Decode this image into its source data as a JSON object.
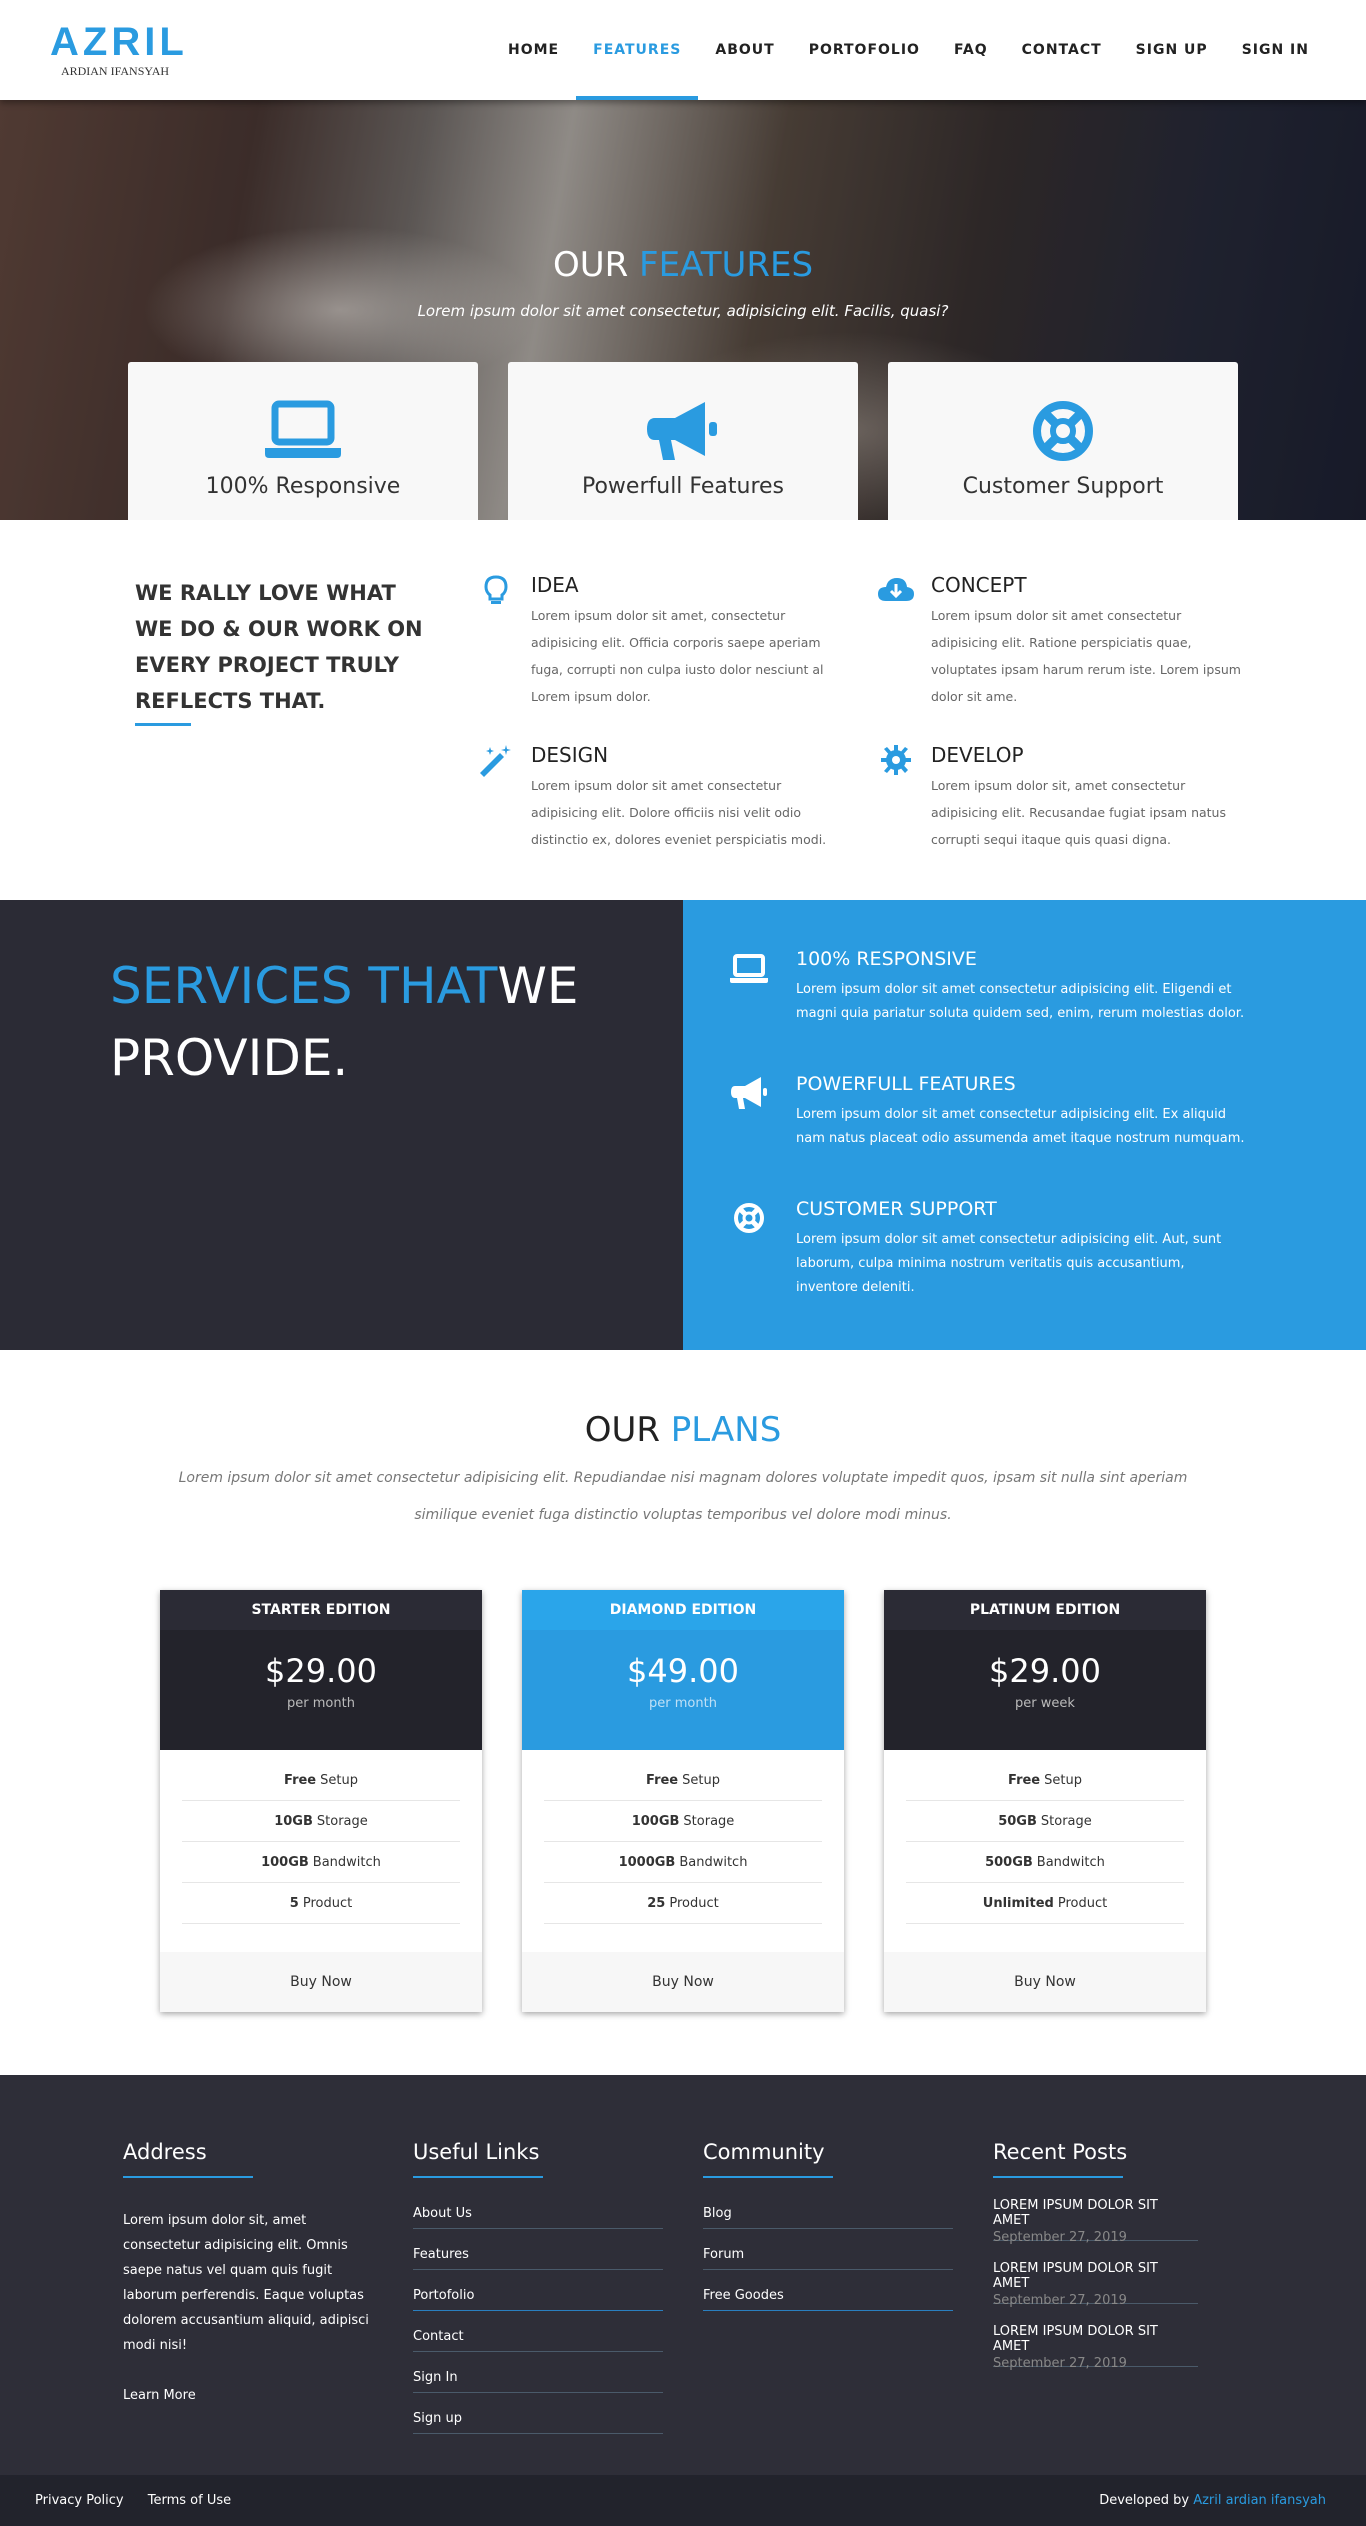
{
  "brand": {
    "name": "AZRIL",
    "sub": "ARDIAN IFANSYAH"
  },
  "nav": [
    {
      "label": "HOME",
      "active": false
    },
    {
      "label": "FEATURES",
      "active": true
    },
    {
      "label": "ABOUT",
      "active": false
    },
    {
      "label": "PORTOFOLIO",
      "active": false
    },
    {
      "label": "FAQ",
      "active": false
    },
    {
      "label": "CONTACT",
      "active": false
    },
    {
      "label": "SIGN UP",
      "active": false
    },
    {
      "label": "SIGN IN",
      "active": false
    }
  ],
  "hero": {
    "title_prefix": "OUR",
    "title_accent": "FEATURES",
    "subtitle": "Lorem ipsum dolor sit amet consectetur, adipisicing elit. Facilis, quasi?",
    "cards": [
      {
        "label": "100% Responsive",
        "icon": "laptop-icon"
      },
      {
        "label": "Powerfull Features",
        "icon": "megaphone-icon"
      },
      {
        "label": "Customer Support",
        "icon": "lifebuoy-icon"
      }
    ]
  },
  "about": {
    "heading": "WE RALLY LOVE WHAT WE DO & OUR WORK ON EVERY PROJECT TRULY REFLECTS THAT.",
    "items": [
      {
        "title": "IDEA",
        "icon": "lightbulb-icon",
        "text": "Lorem ipsum dolor sit amet, consectetur adipisicing elit. Officia corporis saepe aperiam fuga, corrupti non culpa iusto dolor nesciunt al Lorem ipsum dolor."
      },
      {
        "title": "CONCEPT",
        "icon": "cloud-download-icon",
        "text": "Lorem ipsum dolor sit amet consectetur adipisicing elit. Ratione perspiciatis quae, voluptates ipsam harum rerum iste. Lorem ipsum dolor sit ame."
      },
      {
        "title": "DESIGN",
        "icon": "magic-wand-icon",
        "text": "Lorem ipsum dolor sit amet consectetur adipisicing elit. Dolore officiis nisi velit odio distinctio ex, dolores eveniet perspiciatis modi."
      },
      {
        "title": "DEVELOP",
        "icon": "gear-icon",
        "text": "Lorem ipsum dolor sit, amet consectetur adipisicing elit. Recusandae fugiat ipsam natus corrupti sequi itaque quis quasi digna."
      }
    ]
  },
  "services": {
    "title_accent": "SERVICES THAT",
    "title_rest": "WE PROVIDE.",
    "items": [
      {
        "title": "100% RESPONSIVE",
        "icon": "laptop-icon",
        "text": "Lorem ipsum dolor sit amet consectetur adipisicing elit. Eligendi et magni quia pariatur soluta quidem sed, enim, rerum molestias dolor."
      },
      {
        "title": "POWERFULL FEATURES",
        "icon": "megaphone-icon",
        "text": "Lorem ipsum dolor sit amet consectetur adipisicing elit. Ex aliquid nam natus placeat odio assumenda amet itaque nostrum numquam."
      },
      {
        "title": "CUSTOMER SUPPORT",
        "icon": "lifebuoy-icon",
        "text": "Lorem ipsum dolor sit amet consectetur adipisicing elit. Aut, sunt laborum, culpa minima nostrum veritatis quis accusantium, inventore deleniti."
      }
    ]
  },
  "plans": {
    "title_prefix": "OUR",
    "title_accent": "PLANS",
    "subtitle": "Lorem ipsum dolor sit amet consectetur adipisicing elit. Repudiandae nisi magnam dolores voluptate impedit quos, ipsam sit nulla sint aperiam similique eveniet fuga distinctio voluptas temporibus vel dolore modi minus.",
    "cards": [
      {
        "name": "STARTER EDITION",
        "price": "$29.00",
        "period": "per month",
        "featured": false,
        "features": [
          {
            "bold": "Free",
            "rest": "Setup"
          },
          {
            "bold": "10GB",
            "rest": "Storage"
          },
          {
            "bold": "100GB",
            "rest": "Bandwitch"
          },
          {
            "bold": "5",
            "rest": "Product"
          }
        ],
        "button": "Buy Now"
      },
      {
        "name": "DIAMOND EDITION",
        "price": "$49.00",
        "period": "per month",
        "featured": true,
        "features": [
          {
            "bold": "Free",
            "rest": "Setup"
          },
          {
            "bold": "100GB",
            "rest": "Storage"
          },
          {
            "bold": "1000GB",
            "rest": "Bandwitch"
          },
          {
            "bold": "25",
            "rest": "Product"
          }
        ],
        "button": "Buy Now"
      },
      {
        "name": "PLATINUM EDITION",
        "price": "$29.00",
        "period": "per week",
        "featured": false,
        "features": [
          {
            "bold": "Free",
            "rest": "Setup"
          },
          {
            "bold": "50GB",
            "rest": "Storage"
          },
          {
            "bold": "500GB",
            "rest": "Bandwitch"
          },
          {
            "bold": "Unlimited",
            "rest": "Product"
          }
        ],
        "button": "Buy Now"
      }
    ]
  },
  "footer": {
    "address": {
      "title": "Address",
      "text": "Lorem ipsum dolor sit, amet consectetur adipisicing elit. Omnis saepe natus vel quam quis fugit laborum perferendis. Eaque voluptas dolorem accusantium aliquid, adipisci modi nisi!",
      "learn_more": "Learn More"
    },
    "useful_links": {
      "title": "Useful Links",
      "links": [
        "About Us",
        "Features",
        "Portofolio",
        "Contact",
        "Sign In",
        "Sign up"
      ]
    },
    "community": {
      "title": "Community",
      "links": [
        "Blog",
        "Forum",
        "Free Goodes"
      ]
    },
    "recent_posts": {
      "title": "Recent Posts",
      "posts": [
        {
          "title": "LOREM IPSUM DOLOR SIT AMET",
          "date": "September 27, 2019"
        },
        {
          "title": "LOREM IPSUM DOLOR SIT AMET",
          "date": "September 27, 2019"
        },
        {
          "title": "LOREM IPSUM DOLOR SIT AMET",
          "date": "September 27, 2019"
        }
      ]
    }
  },
  "bottombar": {
    "privacy": "Privacy Policy",
    "terms": "Terms of Use",
    "dev_prefix": "Developed by",
    "dev_name": "Azril ardian ifansyah"
  },
  "colors": {
    "accent": "#2a9be0",
    "dark": "#2b2b35",
    "footer": "#2e2e38"
  }
}
